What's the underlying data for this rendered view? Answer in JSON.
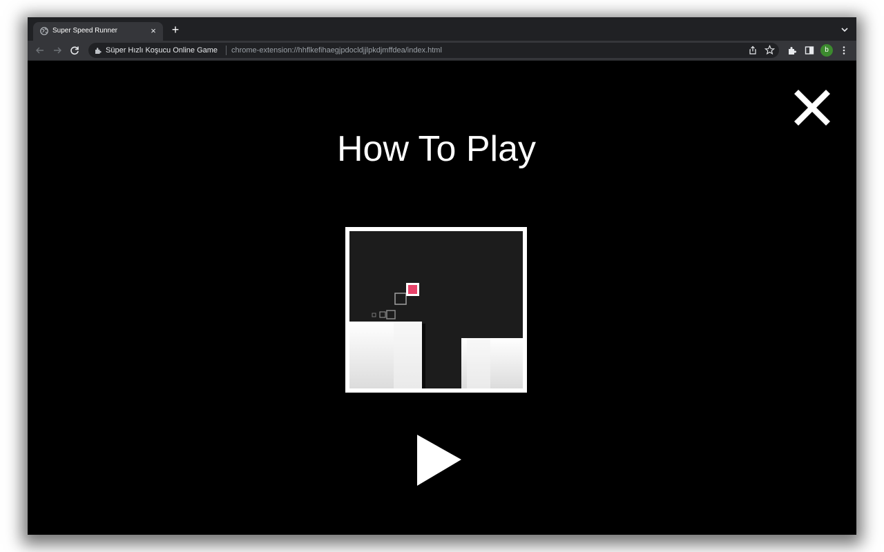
{
  "browser": {
    "tab": {
      "title": "Super Speed Runner",
      "favicon": "globe-icon",
      "close_glyph": "×"
    },
    "new_tab_glyph": "+",
    "omnibox": {
      "site_name": "Süper Hızlı Koşucu Online Game",
      "url": "chrome-extension://hhflkefihaegjpdocldjjlpkdjmffdea/index.html"
    },
    "profile_initial": "b",
    "profile_color": "#3c8a2e",
    "icons": [
      "back-icon",
      "forward-icon",
      "reload-icon",
      "extension-icon",
      "share-icon",
      "star-icon",
      "puzzle-icon",
      "side-panel-icon",
      "menu-icon",
      "tab-search-icon"
    ]
  },
  "game": {
    "title": "How To Play",
    "close_icon": "close-icon",
    "play_icon": "play-icon",
    "colors": {
      "background": "#000000",
      "text": "#ffffff",
      "player": "#e8436a",
      "tutorial_bg": "#1c1c1c",
      "frame": "#ffffff"
    }
  }
}
